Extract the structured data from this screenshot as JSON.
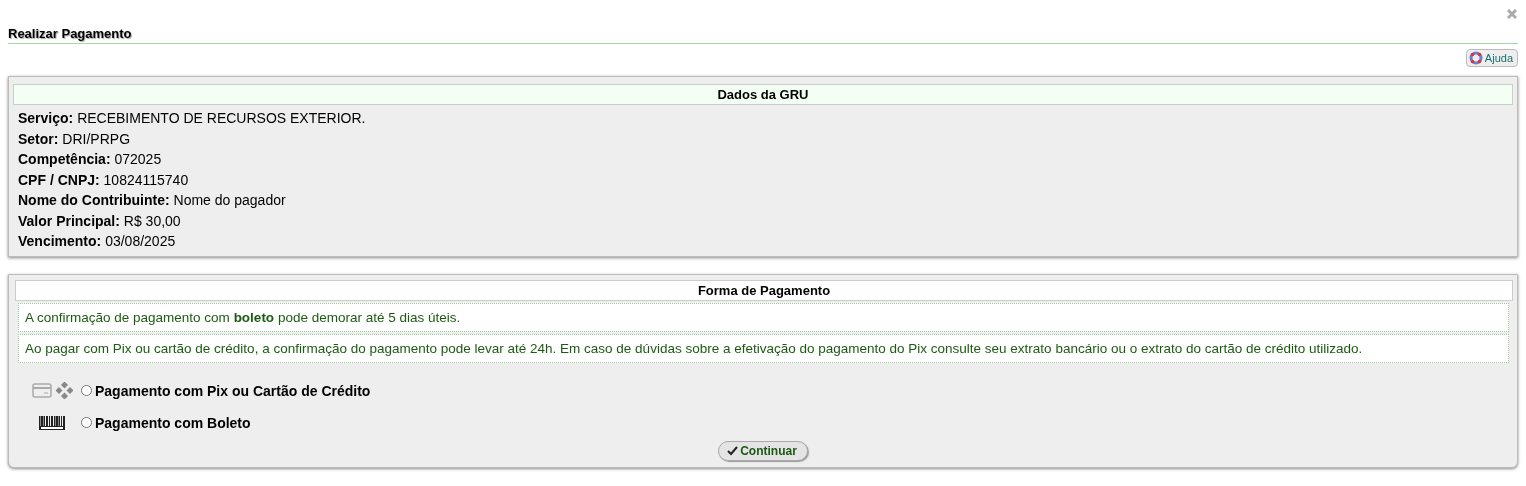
{
  "window": {
    "title": "Realizar Pagamento",
    "help_button": "Ajuda"
  },
  "gru": {
    "title": "Dados da GRU",
    "fields": [
      {
        "text": "**Serviço:** RECEBIMENTO DE RECURSOS EXTERIOR."
      },
      {
        "text": "**Setor:** DRI/PRPG"
      },
      {
        "text": "**Competência:** 072025"
      },
      {
        "text": "**CPF / CNPJ:** 10824115740"
      },
      {
        "text": "**Nome do Contribuinte:** Nome do pagador"
      },
      {
        "text": "**Valor Principal:** R$ 30,00"
      },
      {
        "text": "**Vencimento:** 03/08/2025"
      }
    ]
  },
  "payment": {
    "title": "Forma de Pagamento",
    "notes": [
      "A confirmação de pagamento com **boleto** pode demorar até 5 dias úteis.",
      "Ao pagar com Pix ou cartão de crédito, a confirmação do pagamento pode levar até 24h. Em caso de dúvidas sobre a efetivação do pagamento do Pix consulte seu extrato bancário ou o extrato do cartão de crédito utilizado."
    ],
    "options": [
      {
        "kind": "pix",
        "label": "Pagamento com Pix ou Cartão de Crédito",
        "selected": false
      },
      {
        "kind": "boleto",
        "label": "Pagamento com Boleto",
        "selected": false
      }
    ],
    "submit": "Continuar"
  }
}
